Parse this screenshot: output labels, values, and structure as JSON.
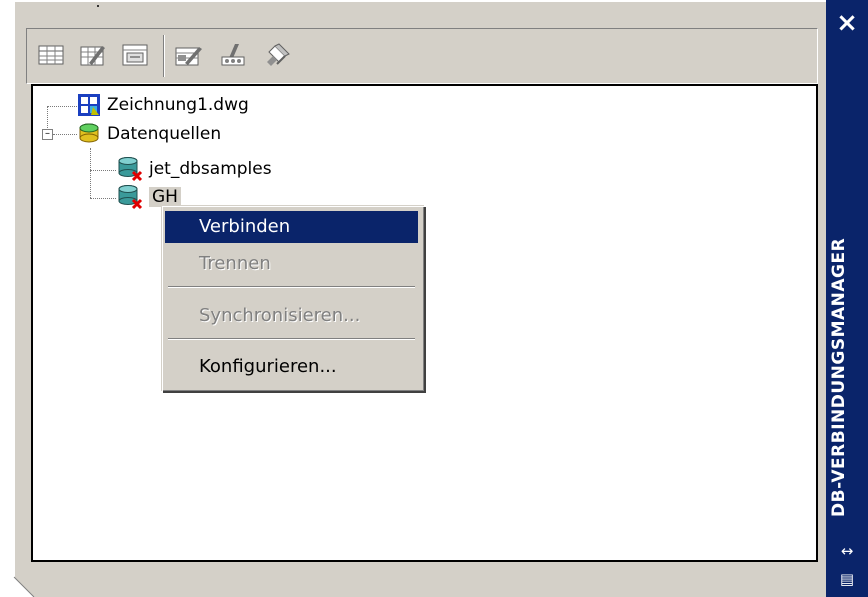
{
  "palette": {
    "title": "DB-VERBINDUNGSMANAGER",
    "close_symbol": "×",
    "autohide_symbol": "↔",
    "properties_symbol": "▤",
    "titlebar_color": "#0a246a",
    "frame_color": "#d4d0c8"
  },
  "toolbar": {
    "buttons": [
      {
        "icon": "view-table-icon"
      },
      {
        "icon": "edit-table-icon"
      },
      {
        "icon": "new-link-template-icon"
      },
      {
        "icon": "new-label-template-icon"
      },
      {
        "icon": "new-query-icon"
      },
      {
        "icon": "link-and-label-icon"
      }
    ]
  },
  "tree": {
    "drawing": "Zeichnung1.dwg",
    "data_sources": "Datenquellen",
    "sources": [
      "jet_dbsamples",
      "GH"
    ]
  },
  "context_menu": {
    "items": [
      {
        "label": "Verbinden",
        "state": "highlighted"
      },
      {
        "label": "Trennen",
        "state": "disabled"
      },
      {
        "label": "Synchronisieren...",
        "state": "disabled"
      },
      {
        "label": "Konfigurieren...",
        "state": "enabled"
      }
    ],
    "highlight_color": "#0a246a"
  }
}
